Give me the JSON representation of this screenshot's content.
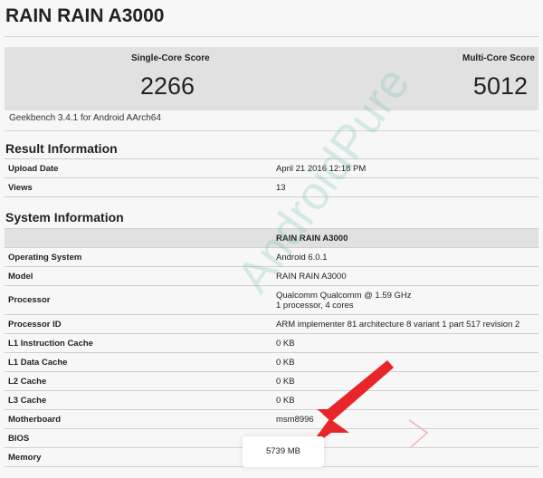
{
  "title": "RAIN RAIN A3000",
  "scores": {
    "single_label": "Single-Core Score",
    "single_value": "2266",
    "multi_label": "Multi-Core Score",
    "multi_value": "5012"
  },
  "benchmark_version": "Geekbench 3.4.1 for Android AArch64",
  "result_info": {
    "heading": "Result Information",
    "rows": [
      {
        "key": "Upload Date",
        "value": "April 21 2016 12:18 PM"
      },
      {
        "key": "Views",
        "value": "13"
      }
    ]
  },
  "system_info": {
    "heading": "System Information",
    "header_value": "RAIN RAIN A3000",
    "rows": [
      {
        "key": "Operating System",
        "value": "Android 6.0.1"
      },
      {
        "key": "Model",
        "value": "RAIN RAIN A3000"
      },
      {
        "key": "Processor",
        "value": "Qualcomm Qualcomm @ 1.59 GHz",
        "value2": "1 processor, 4 cores"
      },
      {
        "key": "Processor ID",
        "value": "ARM implementer 81 architecture 8 variant 1 part 517 revision 2"
      },
      {
        "key": "L1 Instruction Cache",
        "value": "0 KB"
      },
      {
        "key": "L1 Data Cache",
        "value": "0 KB"
      },
      {
        "key": "L2 Cache",
        "value": "0 KB"
      },
      {
        "key": "L3 Cache",
        "value": "0 KB"
      },
      {
        "key": "Motherboard",
        "value": "msm8996"
      },
      {
        "key": "BIOS",
        "value": ""
      },
      {
        "key": "Memory",
        "value": ""
      }
    ]
  },
  "highlight_memory": "5739 MB",
  "watermark": "AndroidPure",
  "colors": {
    "accent_arrow": "#e8262a",
    "panel_bg": "#e1e1e1",
    "watermark": "#5bb8ab"
  }
}
